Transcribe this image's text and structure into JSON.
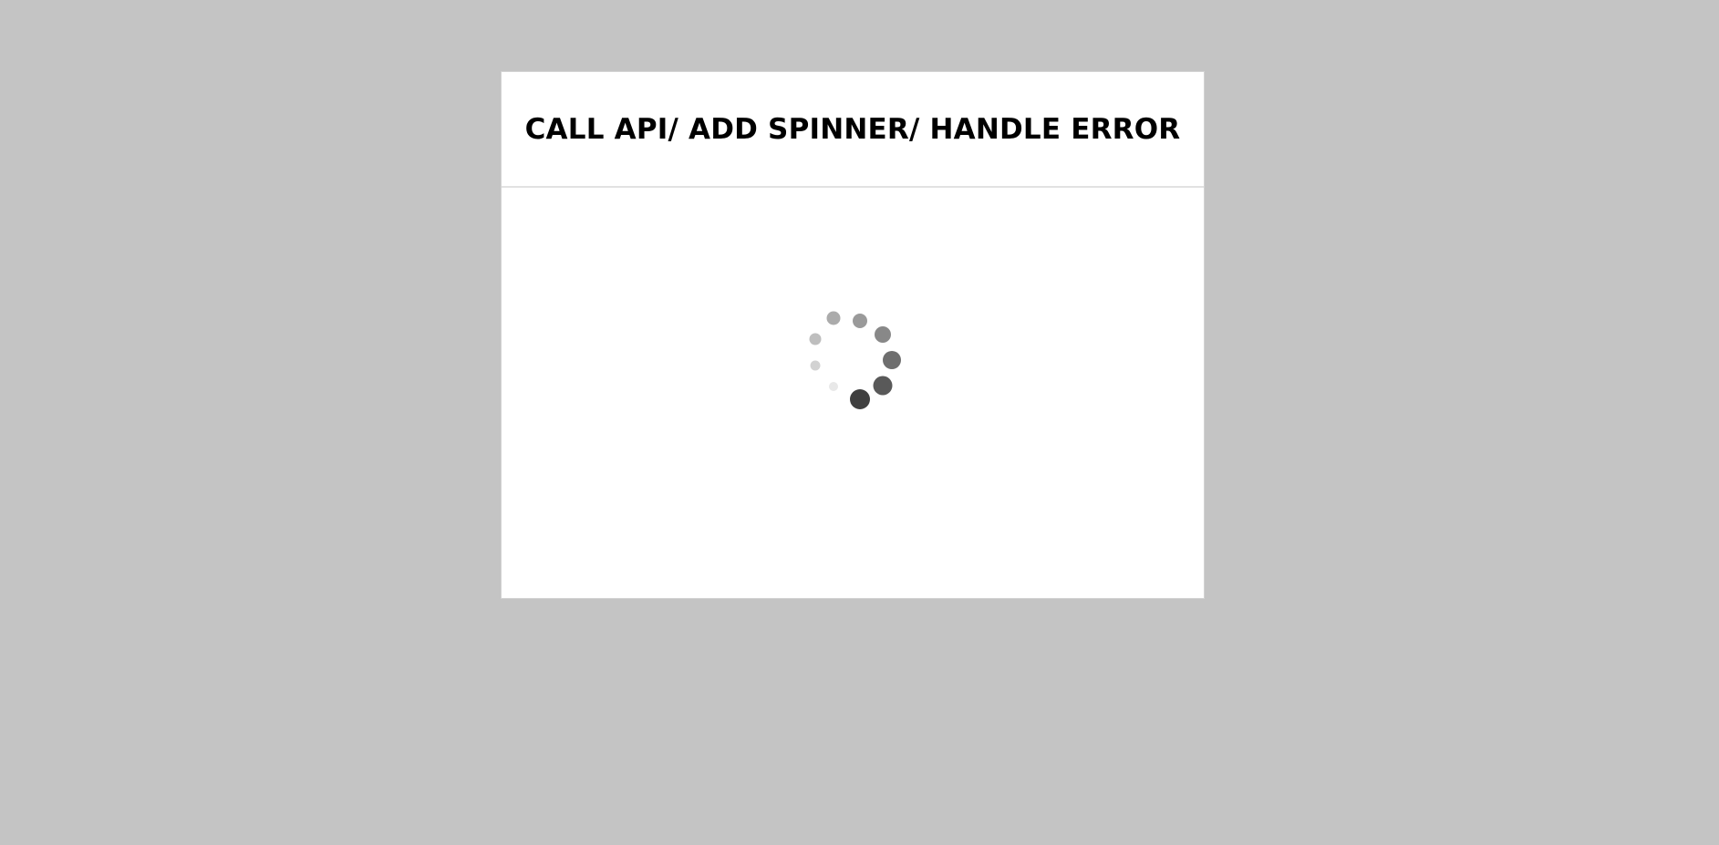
{
  "card": {
    "title": "CALL API/ ADD SPINNER/ HANDLE ERROR"
  },
  "spinner": {
    "icon": "loading-spinner-icon",
    "dot_count": 10,
    "dot_colors": [
      "#888888",
      "#6e6e6e",
      "#595959",
      "#404040",
      "#e8e8e8",
      "#d2d2d2",
      "#bebebe",
      "#ababab",
      "#9a9a9a",
      "#8e8e8e"
    ]
  },
  "colors": {
    "background": "#c4c4c4",
    "card": "#ffffff",
    "title": "#000000"
  }
}
